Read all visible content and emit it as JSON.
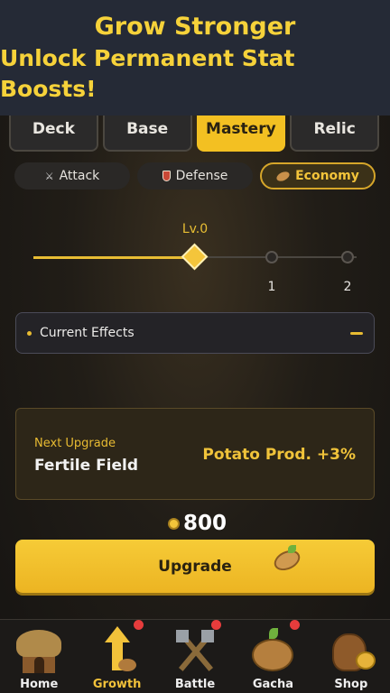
{
  "banner": {
    "line1": "Grow Stronger",
    "line2": "Unlock Permanent Stat Boosts!"
  },
  "tabs": [
    {
      "label": "Deck",
      "active": false
    },
    {
      "label": "Base",
      "active": false
    },
    {
      "label": "Mastery",
      "active": true
    },
    {
      "label": "Relic",
      "active": false
    }
  ],
  "subtabs": [
    {
      "label": "Attack",
      "icon": "crossed-swords-icon",
      "active": false
    },
    {
      "label": "Defense",
      "icon": "shield-icon",
      "active": false
    },
    {
      "label": "Economy",
      "icon": "potato-icon",
      "active": true
    }
  ],
  "level": {
    "label": "Lv.0",
    "nodes": [
      "1",
      "2"
    ]
  },
  "effects": {
    "title": "Current Effects",
    "expanded": true
  },
  "next_upgrade": {
    "label": "Next Upgrade",
    "name": "Fertile Field",
    "effect": "Potato Prod. +3%"
  },
  "cost": {
    "icon": "coin-icon",
    "value": "800"
  },
  "upgrade_button": {
    "label": "Upgrade"
  },
  "nav": [
    {
      "label": "Home",
      "icon": "hut-icon",
      "badge": false,
      "active": false
    },
    {
      "label": "Growth",
      "icon": "arrow-up-icon",
      "badge": true,
      "active": true
    },
    {
      "label": "Battle",
      "icon": "crossed-axes-icon",
      "badge": true,
      "active": false
    },
    {
      "label": "Gacha",
      "icon": "potato-sprout-icon",
      "badge": true,
      "active": false
    },
    {
      "label": "Shop",
      "icon": "money-bag-icon",
      "badge": false,
      "active": false
    }
  ],
  "colors": {
    "accent": "#f3c022",
    "background": "#1c1a18",
    "badge": "#e63c3c"
  }
}
